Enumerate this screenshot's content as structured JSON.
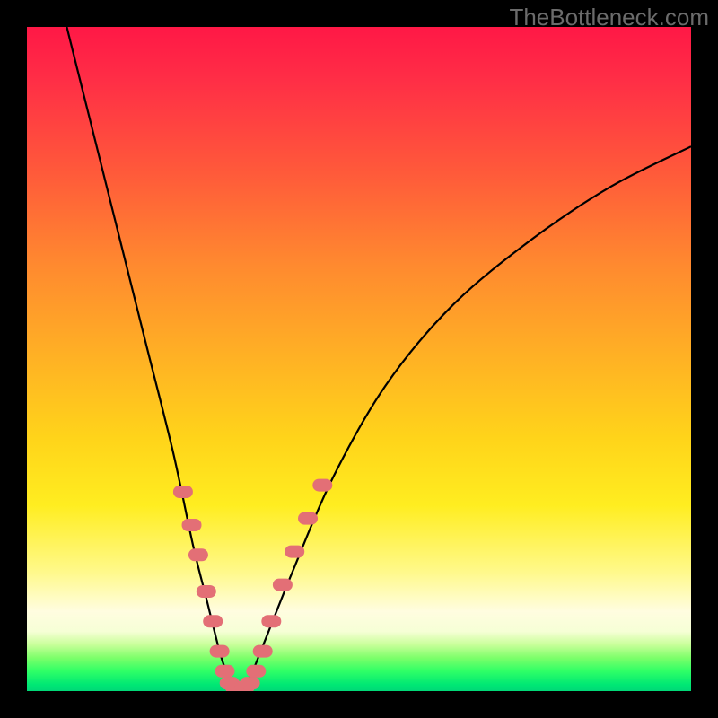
{
  "watermark": "TheBottleneck.com",
  "chart_data": {
    "type": "line",
    "title": "",
    "xlabel": "",
    "ylabel": "",
    "xlim": [
      0,
      100
    ],
    "ylim": [
      0,
      100
    ],
    "series": [
      {
        "name": "bottleneck-curve",
        "x": [
          6,
          10,
          14,
          18,
          22,
          25,
          27,
          29,
          30,
          31,
          32,
          33,
          34,
          36,
          40,
          46,
          54,
          64,
          76,
          88,
          100
        ],
        "values": [
          100,
          84,
          68,
          52,
          36,
          22,
          14,
          6,
          3,
          1,
          0.5,
          1,
          3,
          8,
          18,
          32,
          46,
          58,
          68,
          76,
          82
        ]
      }
    ],
    "markers": {
      "name": "highlight-dots",
      "color": "#e36f76",
      "points": [
        {
          "x": 23.5,
          "y": 30
        },
        {
          "x": 24.8,
          "y": 25
        },
        {
          "x": 25.8,
          "y": 20.5
        },
        {
          "x": 27.0,
          "y": 15
        },
        {
          "x": 28.0,
          "y": 10.5
        },
        {
          "x": 29.0,
          "y": 6
        },
        {
          "x": 29.8,
          "y": 3
        },
        {
          "x": 30.5,
          "y": 1.2
        },
        {
          "x": 31.3,
          "y": 0.6
        },
        {
          "x": 32.0,
          "y": 0.5
        },
        {
          "x": 32.8,
          "y": 0.6
        },
        {
          "x": 33.6,
          "y": 1.2
        },
        {
          "x": 34.5,
          "y": 3
        },
        {
          "x": 35.5,
          "y": 6
        },
        {
          "x": 36.8,
          "y": 10.5
        },
        {
          "x": 38.5,
          "y": 16
        },
        {
          "x": 40.3,
          "y": 21
        },
        {
          "x": 42.3,
          "y": 26
        },
        {
          "x": 44.5,
          "y": 31
        }
      ]
    },
    "gradient_stops": [
      {
        "pos": 0,
        "color": "#ff1846"
      },
      {
        "pos": 50,
        "color": "#ffb224"
      },
      {
        "pos": 88,
        "color": "#fffde0"
      },
      {
        "pos": 100,
        "color": "#00d877"
      }
    ]
  }
}
